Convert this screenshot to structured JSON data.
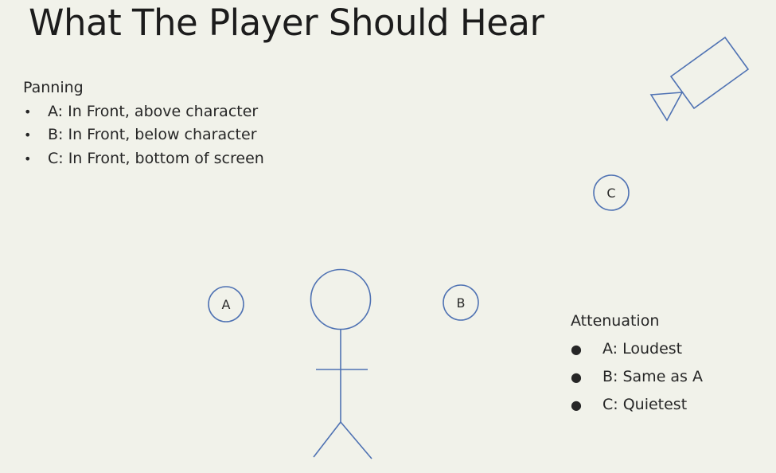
{
  "slide": {
    "title": "What The Player Should Hear"
  },
  "panning": {
    "heading": "Panning",
    "bullets": [
      "A: In Front, above character",
      "B: In Front, below character",
      "C: In Front, bottom of screen"
    ]
  },
  "attenuation": {
    "heading": "Attenuation",
    "bullets": [
      "A: Loudest",
      "B: Same as A",
      "C: Quietest"
    ]
  },
  "diagram": {
    "markers": {
      "a": "A",
      "b": "B",
      "c": "C"
    },
    "icons": {
      "figure": "stick-figure-icon",
      "camera": "camera-icon"
    },
    "colors": {
      "stroke": "#4f72b3",
      "background": "#f1f2ea"
    }
  }
}
